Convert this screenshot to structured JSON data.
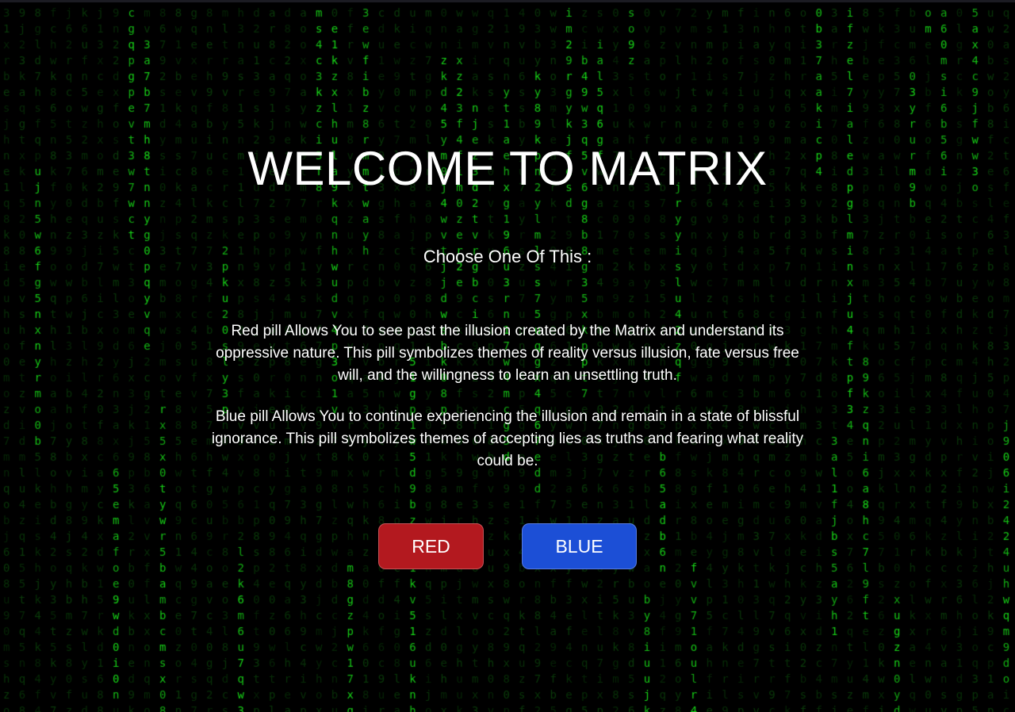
{
  "page": {
    "title": "WELCOME TO MATRIX",
    "subtitle": "Choose One Of This :",
    "red_description": "Red pill Allows You to see past the illusion created by the Matrix and understand its oppressive nature. This pill symbolizes themes of reality versus illusion, fate versus free will, and the willingness to learn an unsettling truth.",
    "blue_description": "Blue pill Allows You to continue experiencing the illusion and remain in a state of blissful ignorance. This pill symbolizes themes of accepting lies as truths and fearing what reality could be."
  },
  "buttons": {
    "red_label": "RED",
    "blue_label": "BLUE"
  },
  "colors": {
    "background": "#000000",
    "rain_bright": "#18d818",
    "rain_dim": "#0a3d0a",
    "red_button": "#b3191f",
    "blue_button": "#1c4fd6",
    "text": "#ffffff"
  },
  "background_effect": {
    "type": "matrix-code-rain",
    "characters": "abcdefghijklmnopqrstuvwxyz0123456789"
  }
}
